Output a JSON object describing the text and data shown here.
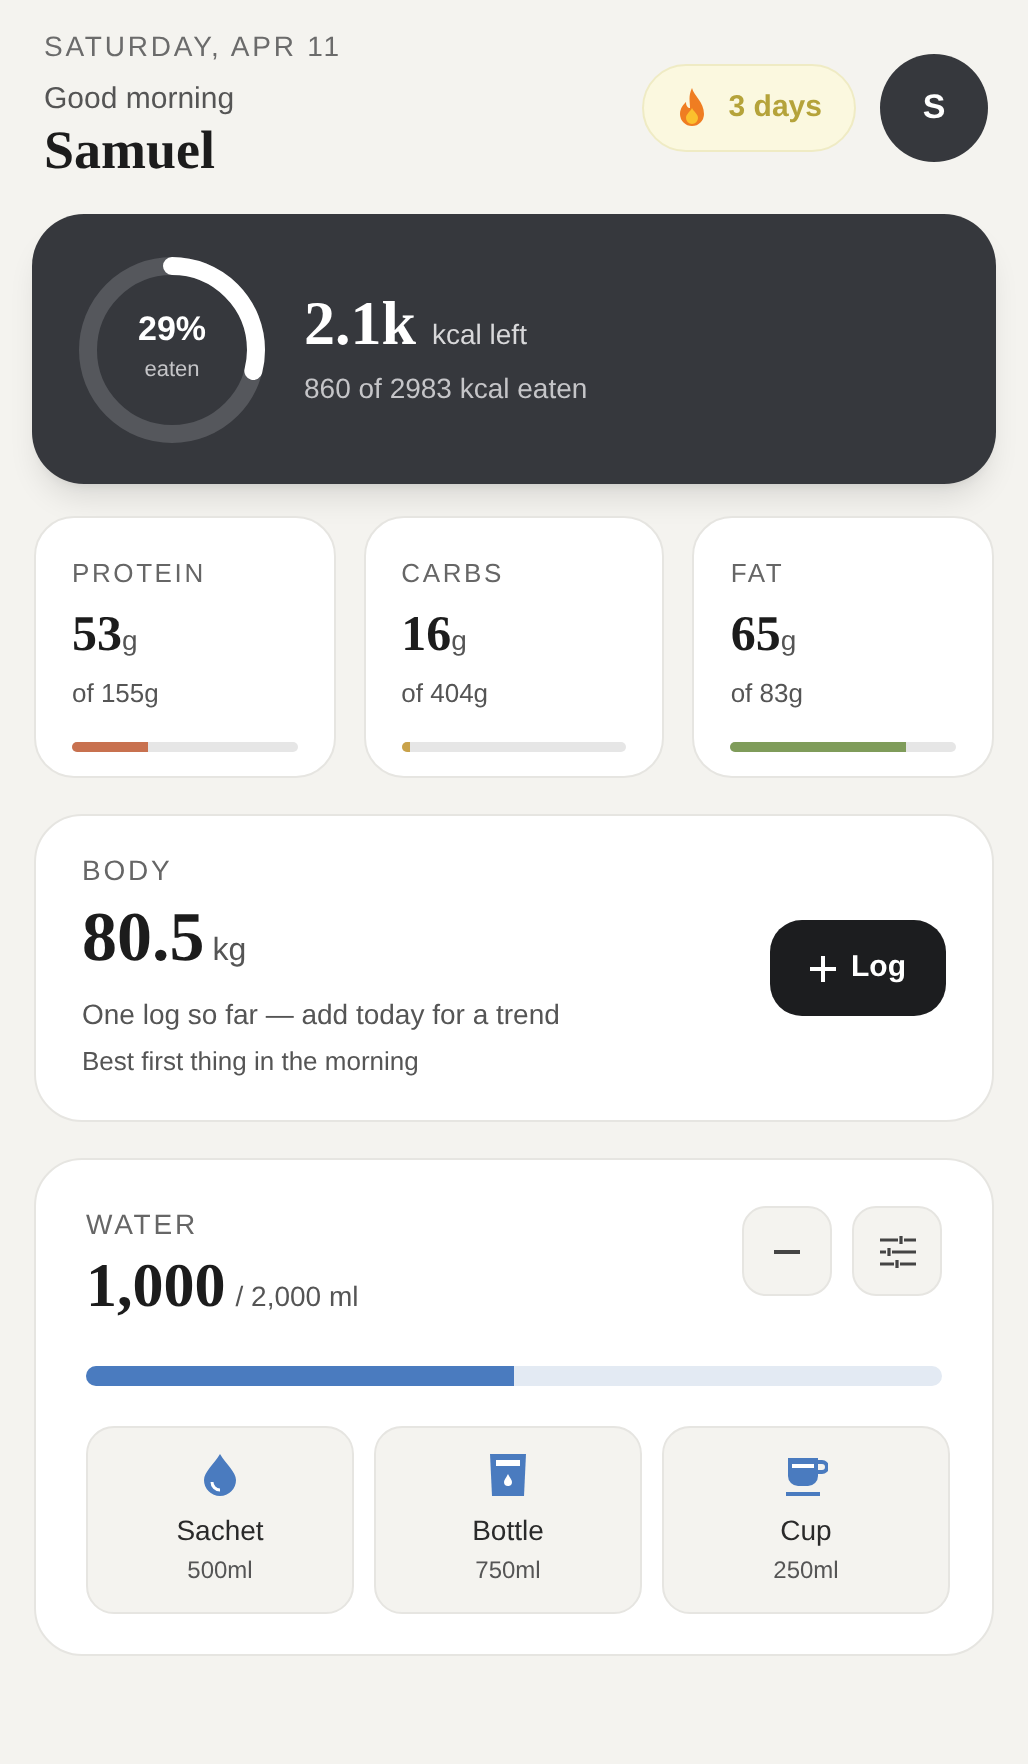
{
  "header": {
    "date": "SATURDAY, APR 11",
    "greeting": "Good morning",
    "name": "Samuel",
    "streak": "3 days",
    "avatar": "S"
  },
  "calories": {
    "level": 0.29,
    "percent": "29%",
    "percent_label": "eaten",
    "left": "2.1k",
    "left_label": "kcal left",
    "eaten": "860 of 2983 kcal eaten"
  },
  "macros": [
    {
      "label": "PROTEIN",
      "value": "53",
      "unit": "g",
      "target": "of 155g",
      "level": 0.34,
      "color": "#c8714f"
    },
    {
      "label": "CARBS",
      "value": "16",
      "unit": "g",
      "target": "of 404g",
      "level": 0.04,
      "color": "#c9a24a"
    },
    {
      "label": "FAT",
      "value": "65",
      "unit": "g",
      "target": "of 83g",
      "level": 0.78,
      "color": "#7f9c5a"
    }
  ],
  "body": {
    "label": "BODY",
    "value": "80.5",
    "unit": "kg",
    "note": "One log so far — add today for a trend",
    "hint": "Best first thing in the morning",
    "button": "Log"
  },
  "water": {
    "label": "WATER",
    "value": "1,000",
    "goal": "/ 2,000 ml",
    "level": 0.5,
    "presets": [
      {
        "kind": "drop",
        "name": "Sachet",
        "amount": "500ml"
      },
      {
        "kind": "bottle",
        "name": "Bottle",
        "amount": "750ml"
      },
      {
        "kind": "cup",
        "name": "Cup",
        "amount": "250ml"
      }
    ]
  }
}
